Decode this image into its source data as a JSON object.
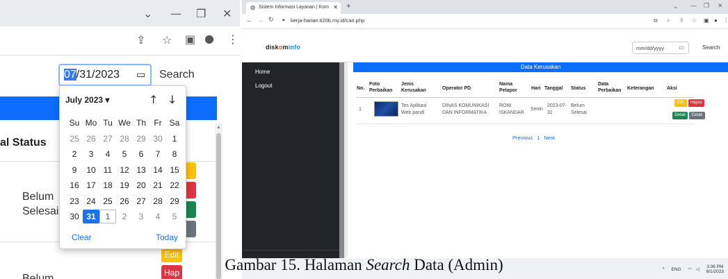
{
  "left": {
    "date_value_selected": "07",
    "date_value_rest": "/31/2023",
    "search_label": "Search",
    "status_header": "Status",
    "status_cut": "al",
    "row1_status_line1": "Belum",
    "row1_status_line2": "Selesai",
    "row2_status": "Belum",
    "edit_label": "Edit",
    "hapus_fragment": "Hap",
    "button_colors": {
      "yellow": "#ffc107",
      "red": "#dc3545",
      "green": "#198754",
      "gray": "#6c757d"
    }
  },
  "calendar": {
    "month_label": "July 2023 ▾",
    "weekdays": [
      "Su",
      "Mo",
      "Tu",
      "We",
      "Th",
      "Fr",
      "Sa"
    ],
    "weeks": [
      [
        "25",
        "26",
        "27",
        "28",
        "29",
        "30",
        "1"
      ],
      [
        "2",
        "3",
        "4",
        "5",
        "6",
        "7",
        "8"
      ],
      [
        "9",
        "10",
        "11",
        "12",
        "13",
        "14",
        "15"
      ],
      [
        "16",
        "17",
        "18",
        "19",
        "20",
        "21",
        "22"
      ],
      [
        "23",
        "24",
        "25",
        "26",
        "27",
        "28",
        "29"
      ],
      [
        "30",
        "31",
        "1",
        "2",
        "3",
        "4",
        "5"
      ]
    ],
    "selected_day": "31",
    "clear_label": "Clear",
    "today_label": "Today"
  },
  "right": {
    "tab_title": "Sistem Informasi Layanan | Kom",
    "url": "kerja-harian.ti20b.my.id/cari.php",
    "logo_a": "disk",
    "logo_b": "o",
    "logo_c": "m",
    "logo_d": "info",
    "date_placeholder": "mm/dd/yyyy",
    "search_label": "Search",
    "sidebar": {
      "home": "Home",
      "logout": "Logout"
    },
    "section_title": "Data Kerusakan",
    "headers": {
      "no": "No.",
      "foto": "Foto\nPerbaikan",
      "jenis": "Jenis\nKerusakan",
      "operator": "Operator PD",
      "nama": "Nama\nPelapor",
      "hari": "Hari",
      "tanggal": "Tanggal",
      "status": "Status",
      "data_perbaikan": "Data\nPerbaikan",
      "keterangan": "Keterangan",
      "aksi": "Aksi"
    },
    "row": {
      "no": "1",
      "jenis": "Tes Aplikasi\nWeb pandi",
      "operator": "DINAS KOMUNIKASI\nDAN INFORMATIKA",
      "nama": "RONI\nISKANDAR",
      "hari": "Senin",
      "tanggal": "2023-07-\n31",
      "status": "Belum\nSelesai"
    },
    "actions": {
      "edit": "Edit",
      "hapus": "Hapus",
      "detail": "Detail",
      "cetak": "Cetak"
    },
    "pager": {
      "prev": "Previous",
      "page": "1",
      "next": "Next"
    },
    "taskbar": {
      "lang": "ENG",
      "time": "3:36 PM",
      "date": "8/1/2023"
    }
  },
  "caption": {
    "prefix": "Gambar 15. Halaman ",
    "italic": "Search",
    "suffix": " Data (Admin)"
  }
}
